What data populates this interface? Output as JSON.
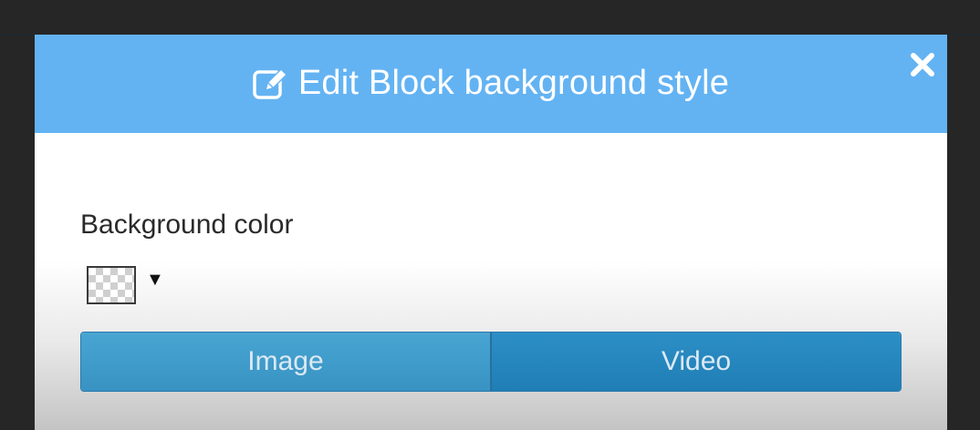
{
  "modal": {
    "title": "Edit Block background style",
    "title_icon": "edit-icon",
    "close_icon": "close-icon"
  },
  "background_color": {
    "label": "Background color",
    "swatch_state": "transparent",
    "caret": "▼"
  },
  "background_type": {
    "options": [
      {
        "label": "Image"
      },
      {
        "label": "Video"
      }
    ]
  },
  "colors": {
    "header": "#63b3f3",
    "button_image": "#3f9fcf",
    "button_video": "#2586bd"
  }
}
